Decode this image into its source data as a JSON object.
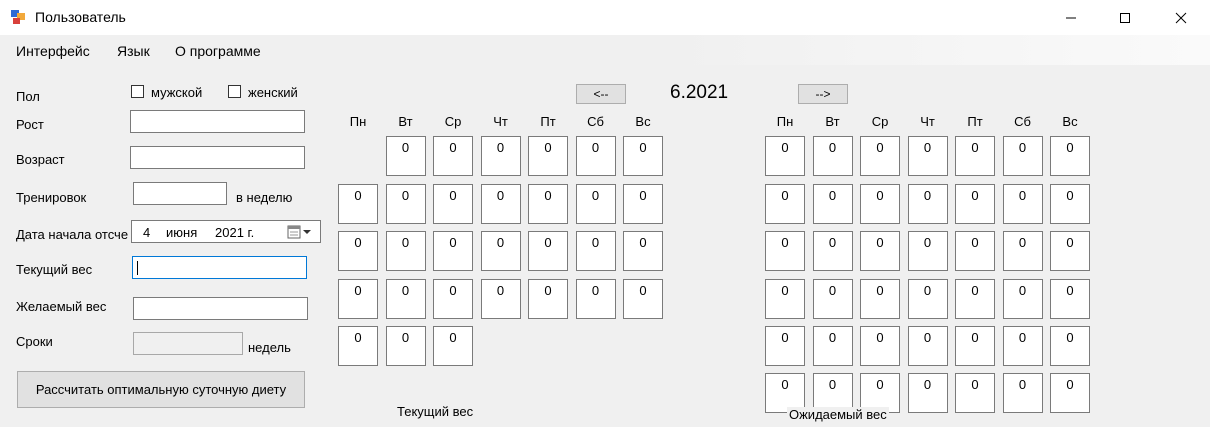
{
  "window": {
    "title": "Пользователь"
  },
  "menu": {
    "items": [
      "Интерфейс",
      "Язык",
      "О программе"
    ]
  },
  "form": {
    "gender_label": "Пол",
    "male_label": "мужской",
    "female_label": "женский",
    "height_label": "Рост",
    "age_label": "Возраст",
    "workouts_label": "Тренировок",
    "per_week_label": "в неделю",
    "start_date_label": "Дата начала отсче",
    "date_day": "4",
    "date_month": "июня",
    "date_year": "2021 г.",
    "current_weight_label": "Текущий вес",
    "desired_weight_label": "Желаемый вес",
    "term_label": "Сроки",
    "weeks_label": "недель",
    "calculate_button": "Рассчитать оптимальную суточную диету"
  },
  "calendar": {
    "prev_button": "<--",
    "next_button": "-->",
    "month_label": "6.2021",
    "day_headers": [
      "Пн",
      "Вт",
      "Ср",
      "Чт",
      "Пт",
      "Сб",
      "Вс"
    ],
    "left_caption": "Текущий вес",
    "right_caption": "Ожидаемый вес",
    "left_rows": [
      [
        "",
        "0",
        "0",
        "0",
        "0",
        "0",
        "0"
      ],
      [
        "0",
        "0",
        "0",
        "0",
        "0",
        "0",
        "0"
      ],
      [
        "0",
        "0",
        "0",
        "0",
        "0",
        "0",
        "0"
      ],
      [
        "0",
        "0",
        "0",
        "0",
        "0",
        "0",
        "0"
      ],
      [
        "0",
        "0",
        "0",
        "",
        "",
        "",
        ""
      ]
    ],
    "right_rows": [
      [
        "0",
        "0",
        "0",
        "0",
        "0",
        "0",
        "0"
      ],
      [
        "0",
        "0",
        "0",
        "0",
        "0",
        "0",
        "0"
      ],
      [
        "0",
        "0",
        "0",
        "0",
        "0",
        "0",
        "0"
      ],
      [
        "0",
        "0",
        "0",
        "0",
        "0",
        "0",
        "0"
      ],
      [
        "0",
        "0",
        "0",
        "0",
        "0",
        "0",
        "0"
      ],
      [
        "0",
        "0",
        "0",
        "0",
        "0",
        "0",
        "0"
      ]
    ]
  }
}
